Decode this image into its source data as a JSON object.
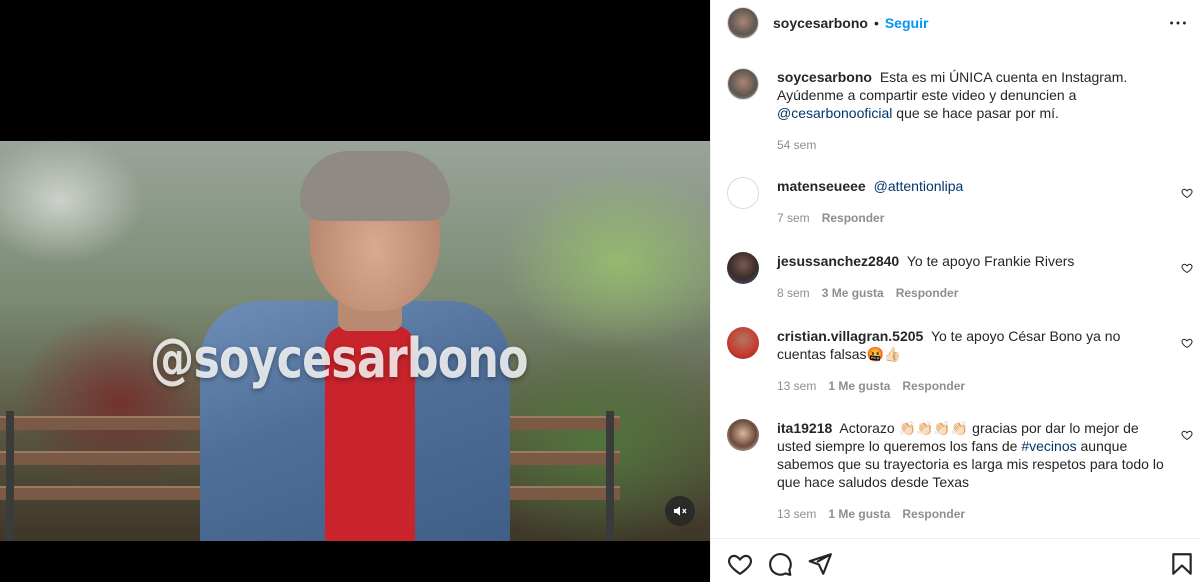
{
  "post": {
    "username": "soycesarbono",
    "separator": "•",
    "follow_label": "Seguir",
    "more_icon": "more-options-icon",
    "video_watermark": "@soycesarbono",
    "caption": {
      "username": "soycesarbono",
      "text_before": "Esta es mi ÚNICA cuenta en Instagram. Ayúdenme a compartir este video y denuncien a",
      "mention": "@cesarbonooficial",
      "text_after": "que se hace pasar por mí.",
      "time": "54 sem"
    }
  },
  "comments": [
    {
      "username": "matenseueee",
      "mention": "@attentionlipa",
      "text": "",
      "time": "7 sem",
      "likes": "",
      "reply": "Responder"
    },
    {
      "username": "jesussanchez2840",
      "text": "Yo te apoyo Frankie Rivers",
      "time": "8 sem",
      "likes": "3 Me gusta",
      "reply": "Responder"
    },
    {
      "username": "cristian.villagran.5205",
      "text": "Yo te apoyo César Bono ya no cuentas falsas🤬👍🏻",
      "time": "13 sem",
      "likes": "1 Me gusta",
      "reply": "Responder"
    },
    {
      "username": "ita19218",
      "text_before": "Actorazo 👏🏻👏🏻👏🏻👏🏻 gracias por dar lo mejor de usted siempre lo queremos los fans de",
      "mention": "#vecinos",
      "text_after": "aunque sabemos que su trayectoria es larga mis respetos para todo lo que hace saludos desde Texas",
      "time": "13 sem",
      "likes": "1 Me gusta",
      "reply": "Responder"
    }
  ],
  "actions": {
    "like_icon": "heart-icon",
    "comment_icon": "comment-icon",
    "share_icon": "share-icon",
    "save_icon": "bookmark-icon"
  }
}
